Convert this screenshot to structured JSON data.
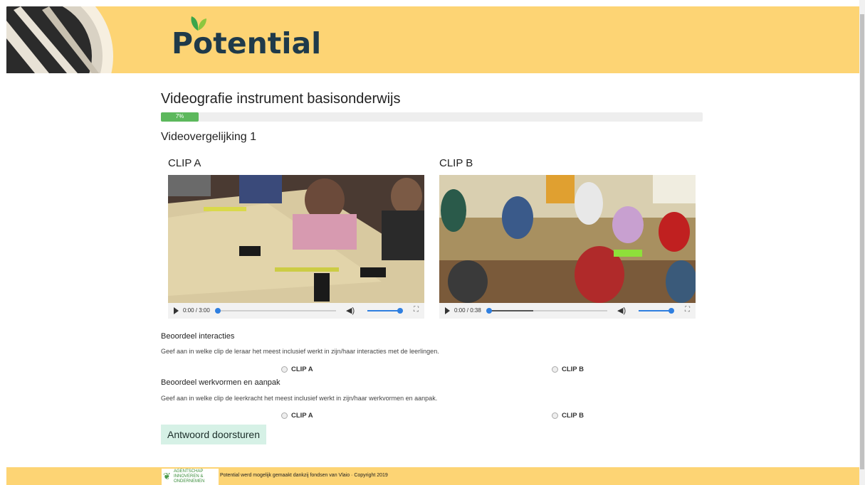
{
  "header": {
    "logo_text": "Potential",
    "brand_color": "#fdd474"
  },
  "page": {
    "title": "Videografie instrument basisonderwijs",
    "progress": {
      "percent": 7,
      "label": "7%"
    },
    "subtitle": "Videovergelijking 1"
  },
  "clips": [
    {
      "label": "CLIP A",
      "time": "0:00 / 3:00",
      "icon_play": "play-icon",
      "icon_volume": "volume-icon",
      "icon_fullscreen": "fullscreen-icon"
    },
    {
      "label": "CLIP B",
      "time": "0:00 / 0:38",
      "icon_play": "play-icon",
      "icon_volume": "volume-icon",
      "icon_fullscreen": "fullscreen-icon"
    }
  ],
  "questions": [
    {
      "heading": "Beoordeel interacties",
      "description": "Geef aan in welke clip de leraar het meest inclusief werkt in zijn/haar interacties met de leerlingen.",
      "options": [
        "CLIP A",
        "CLIP B"
      ]
    },
    {
      "heading": "Beoordeel werkvormen en aanpak",
      "description": "Geef aan in welke clip de leerkracht het meest inclusief werkt in zijn/haar werkvormen en aanpak.",
      "options": [
        "CLIP A",
        "CLIP B"
      ]
    }
  ],
  "submit_label": "Antwoord doorsturen",
  "footer": {
    "logo_lines": [
      "AGENTSCHAP",
      "INNOVEREN &",
      "ONDERNEMEN"
    ],
    "text": "Potential werd mogelijk gemaakt dankzij fondsen van Vlaio · Copyright 2019"
  }
}
